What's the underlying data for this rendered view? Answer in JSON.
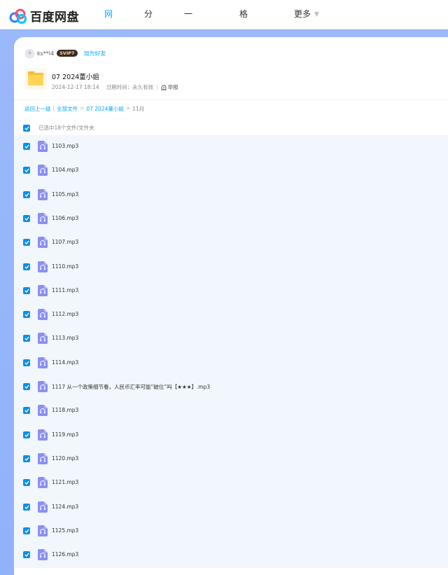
{
  "header": {
    "logo_text": "百度网盘",
    "nav": [
      {
        "label": "网盘",
        "active": true
      },
      {
        "label": "分享",
        "active": false
      },
      {
        "label": "一刻相册",
        "active": false
      },
      {
        "label": "格式转换",
        "active": false
      },
      {
        "label": "更多",
        "active": false
      }
    ],
    "accent_color": "#06a7ff"
  },
  "share": {
    "owner_name": "ks**l4",
    "vip_badge": "SVIP7",
    "add_friend": "加为好友",
    "folder_title": "07 2024董小姐",
    "date": "2024-12-17 18:14",
    "expiry": "过期时间：永久有效",
    "report": "举报"
  },
  "breadcrumb": {
    "back": "返回上一级",
    "sep": "|",
    "all_files": "全部文件",
    "folder": "07 2024董小姐",
    "current": "11月"
  },
  "selection": {
    "summary": "已选中18个文件/文件夹",
    "all_checked": true
  },
  "files": [
    {
      "name": "1103.mp3",
      "checked": true,
      "icon": "audio-file-icon"
    },
    {
      "name": "1104.mp3",
      "checked": true,
      "icon": "audio-file-icon"
    },
    {
      "name": "1105.mp3",
      "checked": true,
      "icon": "audio-file-icon"
    },
    {
      "name": "1106.mp3",
      "checked": true,
      "icon": "audio-file-icon"
    },
    {
      "name": "1107.mp3",
      "checked": true,
      "icon": "audio-file-icon"
    },
    {
      "name": "1110.mp3",
      "checked": true,
      "icon": "audio-file-icon"
    },
    {
      "name": "1111.mp3",
      "checked": true,
      "icon": "audio-file-icon"
    },
    {
      "name": "1112.mp3",
      "checked": true,
      "icon": "audio-file-icon"
    },
    {
      "name": "1113.mp3",
      "checked": true,
      "icon": "audio-file-icon"
    },
    {
      "name": "1114.mp3",
      "checked": true,
      "icon": "audio-file-icon"
    },
    {
      "name": "1117 从一个政策细节看，人民币汇率可能“破位”吗【★★★】.mp3",
      "checked": true,
      "icon": "audio-file-icon"
    },
    {
      "name": "1118.mp3",
      "checked": true,
      "icon": "audio-file-icon"
    },
    {
      "name": "1119.mp3",
      "checked": true,
      "icon": "audio-file-icon"
    },
    {
      "name": "1120.mp3",
      "checked": true,
      "icon": "audio-file-icon"
    },
    {
      "name": "1121.mp3",
      "checked": true,
      "icon": "audio-file-icon"
    },
    {
      "name": "1124.mp3",
      "checked": true,
      "icon": "audio-file-icon"
    },
    {
      "name": "1125.mp3",
      "checked": true,
      "icon": "audio-file-icon"
    },
    {
      "name": "1126.mp3",
      "checked": true,
      "icon": "audio-file-icon"
    }
  ]
}
